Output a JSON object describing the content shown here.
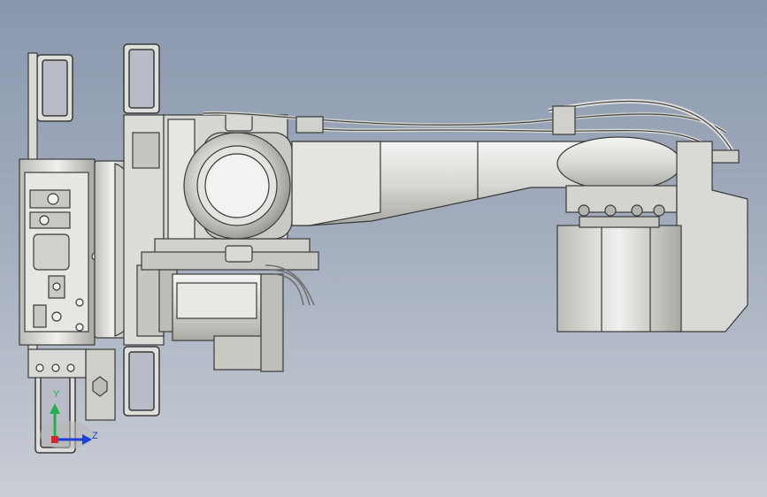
{
  "viewport": {
    "background_top": "#8997ad",
    "background_bottom": "#c9cdd5"
  },
  "model": {
    "name": "robot-arm-assembly",
    "view": "side"
  },
  "triad": {
    "x_color": "#d12a2a",
    "y_color": "#22b14c",
    "z_color": "#1d3fd9",
    "y_label": "Y",
    "z_label": "Z"
  }
}
